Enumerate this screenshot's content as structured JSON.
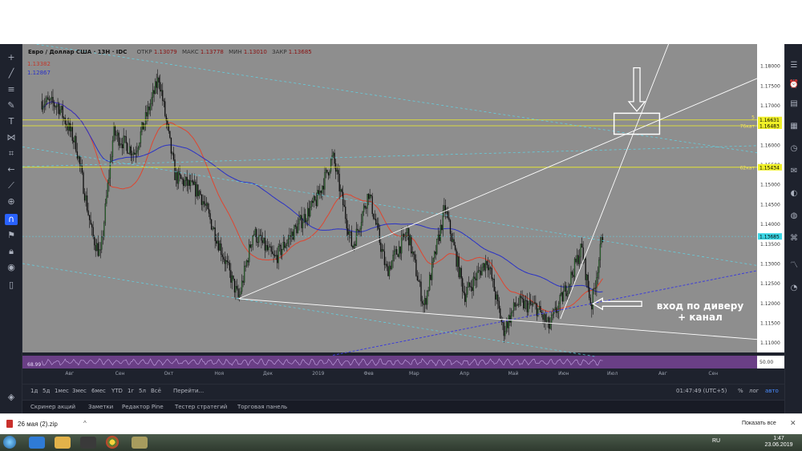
{
  "legend": {
    "symbol": "Евро / Доллар США · 13Н · IDC",
    "open_key": "ОТКР",
    "open": "1.13079",
    "high_key": "МАКС",
    "high": "1.13778",
    "low_key": "МИН",
    "low": "1.13010",
    "close_key": "ЗАКР",
    "close": "1.13685"
  },
  "ma_labels": [
    "1.13382",
    "1.12867"
  ],
  "colors": {
    "plot_bg": "#8e8e8e",
    "candle_up": "#2f7d32",
    "candle_down": "#0b0b0b",
    "ma_red": "#e0452f",
    "ma_blue": "#2a32c6",
    "level_line": "#f0f028",
    "trend_white": "#ffffff",
    "channel_cyan": "#5fd6e8",
    "channel_blue_dash": "#3d3dd9",
    "rsi_bg": "#6a3f86"
  },
  "chart_data": {
    "type": "candlestick",
    "instrument": "Евро / Доллар США, 13Н, IDC",
    "y_axis_ticks": [
      "1.18500",
      "1.18000",
      "1.17500",
      "1.17000",
      "1.16500",
      "1.16000",
      "1.15500",
      "1.15000",
      "1.14500",
      "1.14000",
      "1.13500",
      "1.13000",
      "1.12500",
      "1.12000",
      "1.11500",
      "1.11000"
    ],
    "ylim": [
      1.1075,
      1.1855
    ],
    "x_axis_ticks": [
      "Авг",
      "Сен",
      "Окт",
      "Ноя",
      "Дек",
      "2019",
      "Фев",
      "Мар",
      "Апр",
      "Май",
      "Июн",
      "Июл",
      "Авг",
      "Сен"
    ],
    "x_tick_dates": [
      "2018-08-01",
      "2018-09-01",
      "2018-10-01",
      "2018-11-01",
      "2018-12-01",
      "2019-01-01",
      "2019-02-01",
      "2019-03-01",
      "2019-04-01",
      "2019-05-01",
      "2019-06-01",
      "2019-07-01",
      "2019-08-01",
      "2019-09-01"
    ],
    "price_path": [
      [
        "2018-07-15",
        1.171
      ],
      [
        "2018-07-25",
        1.17
      ],
      [
        "2018-08-05",
        1.16
      ],
      [
        "2018-08-15",
        1.137
      ],
      [
        "2018-08-20",
        1.132
      ],
      [
        "2018-08-28",
        1.163
      ],
      [
        "2018-09-10",
        1.158
      ],
      [
        "2018-09-25",
        1.177
      ],
      [
        "2018-10-05",
        1.152
      ],
      [
        "2018-10-20",
        1.148
      ],
      [
        "2018-11-01",
        1.135
      ],
      [
        "2018-11-13",
        1.121
      ],
      [
        "2018-11-22",
        1.138
      ],
      [
        "2018-12-05",
        1.131
      ],
      [
        "2018-12-15",
        1.137
      ],
      [
        "2018-12-31",
        1.146
      ],
      [
        "2019-01-10",
        1.157
      ],
      [
        "2019-01-22",
        1.134
      ],
      [
        "2019-02-01",
        1.148
      ],
      [
        "2019-02-12",
        1.128
      ],
      [
        "2019-02-25",
        1.138
      ],
      [
        "2019-03-07",
        1.119
      ],
      [
        "2019-03-20",
        1.144
      ],
      [
        "2019-04-01",
        1.122
      ],
      [
        "2019-04-15",
        1.131
      ],
      [
        "2019-04-25",
        1.113
      ],
      [
        "2019-05-03",
        1.12
      ],
      [
        "2019-05-15",
        1.119
      ],
      [
        "2019-05-23",
        1.114
      ],
      [
        "2019-06-04",
        1.125
      ],
      [
        "2019-06-12",
        1.134
      ],
      [
        "2019-06-18",
        1.119
      ],
      [
        "2019-06-25",
        1.137
      ]
    ],
    "price_levels": [
      {
        "value": 1.16631,
        "label": "1.16631",
        "note": "5"
      },
      {
        "value": 1.16483,
        "label": "1.16483",
        "note": "76кат"
      },
      {
        "value": 1.15434,
        "label": "1.15434",
        "note": "62кат"
      }
    ],
    "current_price": {
      "value": 1.13685,
      "label": "1.13685"
    },
    "rsi": {
      "value_label": "68.99",
      "levels_label": "50.00"
    },
    "annotation": "вход по диверу\n+ канал"
  },
  "bottom_bar": {
    "timeframes": [
      "1д",
      "5д",
      "1мес",
      "3мес",
      "6мес",
      "YTD",
      "1г",
      "5л",
      "Всё",
      "Перейти..."
    ],
    "clock": "01:47:49 (UTC+5)",
    "percent": "%",
    "log": "лог",
    "auto": "авто"
  },
  "bottom_tabs": [
    "Скринер акций",
    "Заметки",
    "Редактор Pine",
    "Тестер стратегий",
    "Торговая панель"
  ],
  "download": {
    "file": "26 мая (2).zip",
    "show_all": "Показать все",
    "close": "✕",
    "arrow": "^"
  },
  "taskbar": {
    "lang": "RU",
    "time": "1:47",
    "date": "23.06.2019"
  }
}
